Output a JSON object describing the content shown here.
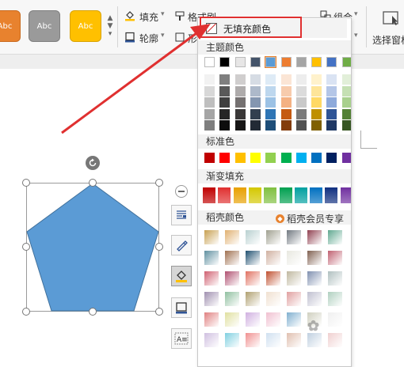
{
  "ribbon": {
    "style_buttons": [
      {
        "label": "Abc",
        "color": "#e8822e"
      },
      {
        "label": "Abc",
        "color": "#9a9a9a"
      },
      {
        "label": "Abc",
        "color": "#ffc000"
      }
    ],
    "fill_label": "填充",
    "outline_label": "轮廓",
    "format_label": "格式刷",
    "shape_label": "形",
    "group_label": "组合",
    "select_pane_label": "选择窗格"
  },
  "dropdown": {
    "no_fill_label": "无填充颜色",
    "theme_colors_label": "主题颜色",
    "standard_colors_label": "标准色",
    "gradient_fill_label": "渐变填充",
    "wk_colors_label": "稻壳颜色",
    "member_label": "稻壳会员专享",
    "theme_top_row": [
      "#ffffff",
      "#000000",
      "#e7e6e6",
      "#44546a",
      "#5b9bd5",
      "#ed7d31",
      "#a5a5a5",
      "#ffc000",
      "#4472c4",
      "#70ad47"
    ],
    "theme_shade_columns": [
      [
        "#f2f2f2",
        "#d8d8d8",
        "#bfbfbf",
        "#a5a5a5",
        "#7f7f7f"
      ],
      [
        "#7f7f7f",
        "#595959",
        "#3f3f3f",
        "#262626",
        "#0d0d0d"
      ],
      [
        "#d0cece",
        "#aeabab",
        "#757171",
        "#3a3838",
        "#171616"
      ],
      [
        "#d6dce4",
        "#adb9ca",
        "#8496b0",
        "#323f4f",
        "#222a35"
      ],
      [
        "#deebf6",
        "#bdd7ee",
        "#9cc2e5",
        "#2e75b5",
        "#1e4e79"
      ],
      [
        "#fbe5d5",
        "#f7cbac",
        "#f4b183",
        "#c55a11",
        "#833c0b"
      ],
      [
        "#ededed",
        "#dbdbdb",
        "#c9c9c9",
        "#7b7b7b",
        "#525252"
      ],
      [
        "#fff2cc",
        "#fee599",
        "#ffd965",
        "#bf9000",
        "#7f6000"
      ],
      [
        "#dae3f3",
        "#b4c6e7",
        "#8eaadb",
        "#2f5496",
        "#1f3864"
      ],
      [
        "#e2efd9",
        "#c5e0b3",
        "#a8d08d",
        "#538135",
        "#375623"
      ]
    ],
    "standard_colors": [
      "#c00000",
      "#ff0000",
      "#ffc000",
      "#ffff00",
      "#92d050",
      "#00b050",
      "#00b0f0",
      "#0070c0",
      "#002060",
      "#7030a0"
    ],
    "gradient_colors": [
      "#c00000",
      "#e03030",
      "#e8a000",
      "#d4c800",
      "#80c040",
      "#00a050",
      "#00a0a0",
      "#0070c0",
      "#103080",
      "#7030a0"
    ],
    "wk_grid": [
      [
        "#c8a050",
        "#e0b070",
        "#b8d0d0",
        "#a0a090",
        "#707880",
        "#904050",
        "#60a890"
      ],
      [
        "#6090a0",
        "#a07050",
        "#205070",
        "#d0b0a0",
        "#e8e8e0",
        "#806050",
        "#c06070"
      ],
      [
        "#d06070",
        "#b05070",
        "#e07060",
        "#c05030",
        "#c0b8a0",
        "#8090b0",
        "#b0c0c0"
      ],
      [
        "#a090b0",
        "#90c0a0",
        "#b0a070",
        "#f0e0d0",
        "#e0a0a0",
        "#c0c0d0",
        "#b0d0c0"
      ],
      [
        "#e08080",
        "#e0e0a0",
        "#d0b0e0",
        "#f0c0d0",
        "#80b0d0",
        "#d0d0c0",
        "#f0f0f0"
      ],
      [
        "#d0c0e0",
        "#80d0e0",
        "#f09090",
        "#d0e0f0",
        "#e0c0b0",
        "#c0d0e0",
        "#f0d0d0"
      ]
    ]
  },
  "shape": {
    "fill_color": "#5b9bd5",
    "stroke_color": "#41719c"
  },
  "side_tools": [
    "layout-icon",
    "pen-icon",
    "fill-bucket-icon",
    "outline-icon",
    "text-wrap-icon"
  ]
}
